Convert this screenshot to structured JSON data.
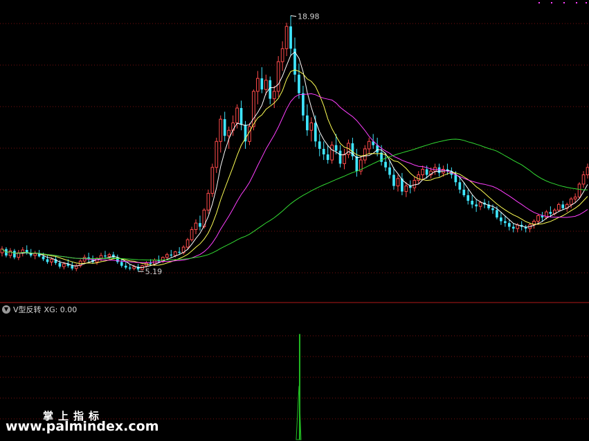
{
  "indicator": {
    "name": "V型反转",
    "value_label": "XG: 0.00"
  },
  "watermark": {
    "cn": "掌上指标",
    "url": "www.palmindex.com"
  },
  "icons": {
    "collapse": "chevron-down-icon"
  },
  "colors": {
    "background": "#000000",
    "up": "#ff4b4b",
    "down": "#3fe6ff",
    "ma5": "#ffffff",
    "ma10": "#ffff55",
    "ma20": "#ff3fff",
    "ma60": "#33dd33",
    "signal": "#22bb22",
    "grid": "#7a1010",
    "divider": "#b01818"
  },
  "chart_data": [
    {
      "type": "candlestick",
      "price_range": [
        4.0,
        19.6
      ],
      "annotations": [
        {
          "text": "18.98",
          "kind": "high",
          "bar": 70,
          "value": 18.98
        },
        {
          "text": "5.19",
          "kind": "low",
          "bar": 33,
          "value": 5.19
        }
      ],
      "ohlc": [
        [
          6.2,
          6.55,
          6.0,
          6.4
        ],
        [
          6.4,
          6.5,
          5.95,
          6.05
        ],
        [
          6.05,
          6.45,
          5.9,
          6.3
        ],
        [
          6.3,
          6.4,
          5.85,
          5.95
        ],
        [
          5.95,
          6.35,
          5.8,
          6.2
        ],
        [
          6.2,
          6.5,
          6.0,
          6.35
        ],
        [
          6.35,
          6.6,
          6.1,
          6.2
        ],
        [
          6.2,
          6.4,
          5.95,
          6.05
        ],
        [
          6.05,
          6.3,
          5.85,
          6.15
        ],
        [
          6.15,
          6.35,
          5.95,
          6.0
        ],
        [
          6.0,
          6.2,
          5.75,
          5.85
        ],
        [
          5.85,
          6.05,
          5.6,
          5.7
        ],
        [
          5.7,
          5.95,
          5.5,
          5.85
        ],
        [
          5.85,
          6.05,
          5.55,
          5.65
        ],
        [
          5.65,
          5.8,
          5.35,
          5.45
        ],
        [
          5.45,
          5.7,
          5.3,
          5.6
        ],
        [
          5.6,
          5.85,
          5.4,
          5.5
        ],
        [
          5.5,
          5.7,
          5.25,
          5.35
        ],
        [
          5.35,
          5.6,
          5.2,
          5.5
        ],
        [
          5.5,
          5.85,
          5.4,
          5.75
        ],
        [
          5.75,
          6.1,
          5.6,
          5.95
        ],
        [
          5.95,
          6.2,
          5.7,
          5.85
        ],
        [
          5.85,
          6.05,
          5.6,
          5.7
        ],
        [
          5.7,
          5.95,
          5.55,
          5.9
        ],
        [
          5.9,
          6.2,
          5.75,
          6.05
        ],
        [
          6.05,
          6.3,
          5.85,
          6.0
        ],
        [
          6.0,
          6.2,
          5.8,
          6.1
        ],
        [
          6.1,
          6.25,
          5.85,
          5.95
        ],
        [
          5.95,
          6.1,
          5.6,
          5.7
        ],
        [
          5.7,
          5.85,
          5.4,
          5.5
        ],
        [
          5.5,
          5.7,
          5.3,
          5.4
        ],
        [
          5.4,
          5.6,
          5.25,
          5.35
        ],
        [
          5.35,
          5.55,
          5.25,
          5.45
        ],
        [
          5.45,
          5.6,
          5.19,
          5.3
        ],
        [
          5.3,
          5.55,
          5.25,
          5.5
        ],
        [
          5.5,
          5.75,
          5.4,
          5.65
        ],
        [
          5.65,
          5.85,
          5.5,
          5.6
        ],
        [
          5.6,
          5.9,
          5.5,
          5.8
        ],
        [
          5.8,
          6.05,
          5.65,
          5.75
        ],
        [
          5.75,
          6.0,
          5.65,
          5.95
        ],
        [
          5.95,
          6.2,
          5.8,
          6.1
        ],
        [
          6.1,
          6.35,
          5.95,
          6.05
        ],
        [
          6.05,
          6.3,
          5.95,
          6.25
        ],
        [
          6.25,
          6.5,
          6.1,
          6.2
        ],
        [
          6.2,
          6.6,
          6.1,
          6.5
        ],
        [
          6.5,
          7.0,
          6.4,
          6.9
        ],
        [
          6.9,
          7.6,
          6.8,
          7.45
        ],
        [
          7.45,
          8.0,
          7.2,
          7.8
        ],
        [
          7.8,
          8.2,
          7.4,
          7.6
        ],
        [
          7.6,
          8.6,
          7.5,
          8.5
        ],
        [
          8.5,
          9.6,
          8.3,
          9.4
        ],
        [
          9.4,
          11.0,
          9.2,
          10.8
        ],
        [
          10.8,
          12.4,
          10.5,
          12.2
        ],
        [
          12.2,
          13.6,
          11.6,
          13.4
        ],
        [
          13.4,
          13.8,
          12.2,
          12.5
        ],
        [
          12.5,
          13.0,
          11.8,
          12.8
        ],
        [
          12.8,
          13.6,
          12.5,
          13.2
        ],
        [
          13.2,
          14.2,
          12.9,
          14.0
        ],
        [
          14.0,
          14.4,
          12.8,
          13.1
        ],
        [
          13.1,
          13.3,
          11.8,
          12.2
        ],
        [
          12.2,
          13.2,
          12.0,
          13.0
        ],
        [
          13.0,
          15.0,
          12.8,
          14.9
        ],
        [
          14.9,
          16.0,
          14.2,
          15.6
        ],
        [
          15.6,
          16.2,
          14.8,
          15.0
        ],
        [
          15.0,
          15.8,
          14.7,
          15.5
        ],
        [
          15.5,
          15.7,
          14.2,
          14.5
        ],
        [
          14.5,
          15.2,
          14.0,
          14.9
        ],
        [
          14.9,
          16.8,
          14.6,
          16.5
        ],
        [
          16.5,
          17.6,
          16.0,
          17.2
        ],
        [
          17.2,
          18.6,
          16.8,
          18.4
        ],
        [
          18.4,
          18.98,
          16.8,
          17.2
        ],
        [
          17.2,
          17.8,
          15.4,
          15.8
        ],
        [
          15.8,
          16.4,
          14.5,
          14.8
        ],
        [
          14.8,
          15.2,
          13.3,
          13.6
        ],
        [
          13.6,
          14.2,
          12.5,
          12.8
        ],
        [
          12.8,
          13.5,
          12.2,
          13.2
        ],
        [
          13.2,
          13.6,
          11.9,
          12.2
        ],
        [
          12.2,
          12.6,
          11.4,
          11.8
        ],
        [
          11.8,
          12.2,
          11.2,
          11.5
        ],
        [
          11.5,
          12.0,
          11.0,
          11.2
        ],
        [
          11.2,
          12.2,
          11.0,
          12.0
        ],
        [
          12.0,
          12.6,
          11.5,
          11.7
        ],
        [
          11.7,
          12.0,
          10.8,
          11.0
        ],
        [
          11.0,
          11.8,
          10.7,
          11.5
        ],
        [
          11.5,
          12.3,
          11.3,
          12.1
        ],
        [
          12.1,
          12.4,
          11.2,
          11.4
        ],
        [
          11.4,
          11.8,
          10.3,
          10.6
        ],
        [
          10.6,
          11.4,
          10.4,
          11.2
        ],
        [
          11.2,
          12.0,
          11.0,
          11.8
        ],
        [
          11.8,
          12.4,
          11.5,
          12.2
        ],
        [
          12.2,
          12.6,
          11.8,
          12.0
        ],
        [
          12.0,
          12.4,
          11.4,
          11.6
        ],
        [
          11.6,
          12.0,
          10.9,
          11.1
        ],
        [
          11.1,
          11.6,
          10.6,
          10.8
        ],
        [
          10.8,
          11.2,
          10.2,
          10.4
        ],
        [
          10.4,
          10.8,
          9.6,
          9.8
        ],
        [
          9.8,
          10.4,
          9.5,
          10.2
        ],
        [
          10.2,
          10.5,
          9.3,
          9.5
        ],
        [
          9.5,
          10.0,
          9.2,
          9.8
        ],
        [
          9.8,
          10.1,
          9.4,
          9.7
        ],
        [
          9.7,
          10.3,
          9.5,
          10.1
        ],
        [
          10.1,
          10.6,
          9.9,
          10.4
        ],
        [
          10.4,
          10.9,
          10.1,
          10.7
        ],
        [
          10.7,
          10.9,
          10.2,
          10.4
        ],
        [
          10.4,
          10.8,
          10.2,
          10.6
        ],
        [
          10.6,
          11.0,
          10.4,
          10.8
        ],
        [
          10.8,
          11.0,
          10.3,
          10.5
        ],
        [
          10.5,
          10.9,
          10.3,
          10.7
        ],
        [
          10.7,
          11.0,
          10.4,
          10.6
        ],
        [
          10.6,
          10.8,
          10.2,
          10.4
        ],
        [
          10.4,
          10.6,
          9.8,
          10.0
        ],
        [
          10.0,
          10.3,
          9.4,
          9.6
        ],
        [
          9.6,
          10.0,
          9.2,
          9.3
        ],
        [
          9.3,
          9.6,
          8.8,
          9.0
        ],
        [
          9.0,
          9.3,
          8.6,
          8.8
        ],
        [
          8.8,
          9.1,
          8.4,
          8.7
        ],
        [
          8.7,
          9.0,
          8.5,
          8.9
        ],
        [
          8.9,
          9.1,
          8.6,
          8.8
        ],
        [
          8.8,
          9.0,
          8.5,
          8.6
        ],
        [
          8.6,
          8.8,
          8.3,
          8.5
        ],
        [
          8.5,
          8.7,
          8.0,
          8.1
        ],
        [
          8.1,
          8.4,
          7.7,
          7.9
        ],
        [
          7.9,
          8.2,
          7.6,
          7.8
        ],
        [
          7.8,
          8.0,
          7.4,
          7.6
        ],
        [
          7.6,
          7.8,
          7.3,
          7.5
        ],
        [
          7.5,
          7.8,
          7.3,
          7.7
        ],
        [
          7.7,
          7.9,
          7.4,
          7.6
        ],
        [
          7.6,
          7.7,
          7.3,
          7.5
        ],
        [
          7.5,
          7.8,
          7.3,
          7.7
        ],
        [
          7.7,
          8.0,
          7.5,
          7.9
        ],
        [
          7.9,
          8.3,
          7.7,
          8.2
        ],
        [
          8.2,
          8.4,
          7.9,
          8.1
        ],
        [
          8.1,
          8.5,
          8.0,
          8.4
        ],
        [
          8.4,
          8.7,
          8.1,
          8.3
        ],
        [
          8.3,
          8.6,
          8.2,
          8.5
        ],
        [
          8.5,
          8.9,
          8.4,
          8.8
        ],
        [
          8.8,
          9.0,
          8.5,
          8.6
        ],
        [
          8.6,
          8.9,
          8.4,
          8.8
        ],
        [
          8.8,
          9.2,
          8.6,
          9.1
        ],
        [
          9.1,
          9.4,
          8.9,
          9.2
        ],
        [
          9.2,
          10.0,
          9.1,
          9.9
        ],
        [
          9.9,
          10.6,
          9.7,
          10.4
        ],
        [
          10.4,
          11.0,
          10.2,
          10.8
        ]
      ],
      "series": [
        {
          "key": "ma5",
          "period": 5
        },
        {
          "key": "ma10",
          "period": 10
        },
        {
          "key": "ma20",
          "period": 20
        },
        {
          "key": "ma60",
          "period": 60
        }
      ]
    },
    {
      "type": "bar",
      "series": [
        {
          "values_note_none": true
        }
      ],
      "signal": {
        "bar": 72,
        "value": 1.0
      },
      "value_range": [
        0,
        1.2
      ]
    }
  ]
}
